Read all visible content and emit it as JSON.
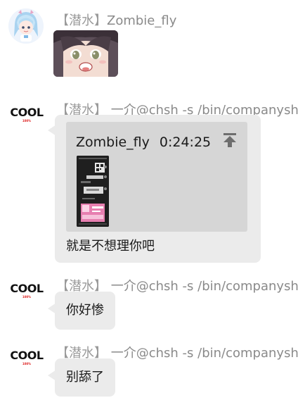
{
  "messages": [
    {
      "sender_title": "【潜水】",
      "sender_name": "Zombie_fly",
      "avatar_icon": "anime-avatar-icon",
      "content_type": "image",
      "image_icon": "anime-face-sticker"
    },
    {
      "sender_title": "【潜水】",
      "sender_name": "一介@chsh -s /bin/companysh",
      "avatar_text": "COOL",
      "avatar_subtext": "100%",
      "content_type": "reply",
      "quote": {
        "author": "Zombie_fly",
        "time": "0:24:25",
        "thumbnail_icon": "chat-screenshot-thumbnail",
        "jump_icon": "jump-to-top-icon"
      },
      "text": "就是不想理你吧"
    },
    {
      "sender_title": "【潜水】",
      "sender_name": "一介@chsh -s /bin/companysh",
      "avatar_text": "COOL",
      "avatar_subtext": "100%",
      "content_type": "text",
      "text": "你好惨"
    },
    {
      "sender_title": "【潜水】",
      "sender_name": "一介@chsh -s /bin/companysh",
      "avatar_text": "COOL",
      "avatar_subtext": "100%",
      "content_type": "text",
      "text": "别舔了"
    }
  ],
  "colors": {
    "bubble": "#ebebeb",
    "quote_box": "#d6d6d6",
    "sender_text": "#8a8a8a"
  }
}
